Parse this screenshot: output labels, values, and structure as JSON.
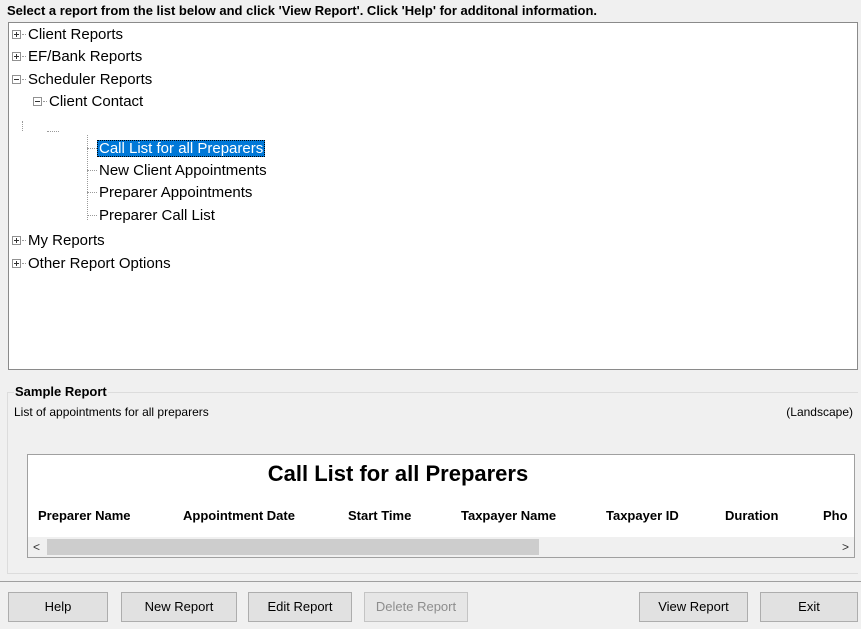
{
  "instruction": "Select a report from the list below and click 'View Report'.  Click 'Help' for additonal information.",
  "tree": {
    "client_reports": "Client Reports",
    "ef_bank_reports": "EF/Bank Reports",
    "scheduler_reports": "Scheduler Reports",
    "client_contact": "Client Contact",
    "call_list_all": "Call List for all Preparers",
    "new_client_appts": "New Client Appointments",
    "preparer_appts": "Preparer Appointments",
    "preparer_call_list": "Preparer Call List",
    "my_reports": "My Reports",
    "other_options": "Other Report Options"
  },
  "sample": {
    "group_title": "Sample Report",
    "description": "List of appointments for all preparers",
    "orientation": "(Landscape)",
    "preview_title": "Call List for all Preparers",
    "columns": [
      "Preparer Name",
      "Appointment Date",
      "Start Time",
      "Taxpayer Name",
      "Taxpayer ID",
      "Duration",
      "Pho"
    ],
    "scroll_left": "<",
    "scroll_right": ">"
  },
  "buttons": {
    "help": "Help",
    "new_report": "New Report",
    "edit_report": "Edit Report",
    "delete_report": "Delete Report",
    "view_report": "View Report",
    "exit": "Exit"
  }
}
